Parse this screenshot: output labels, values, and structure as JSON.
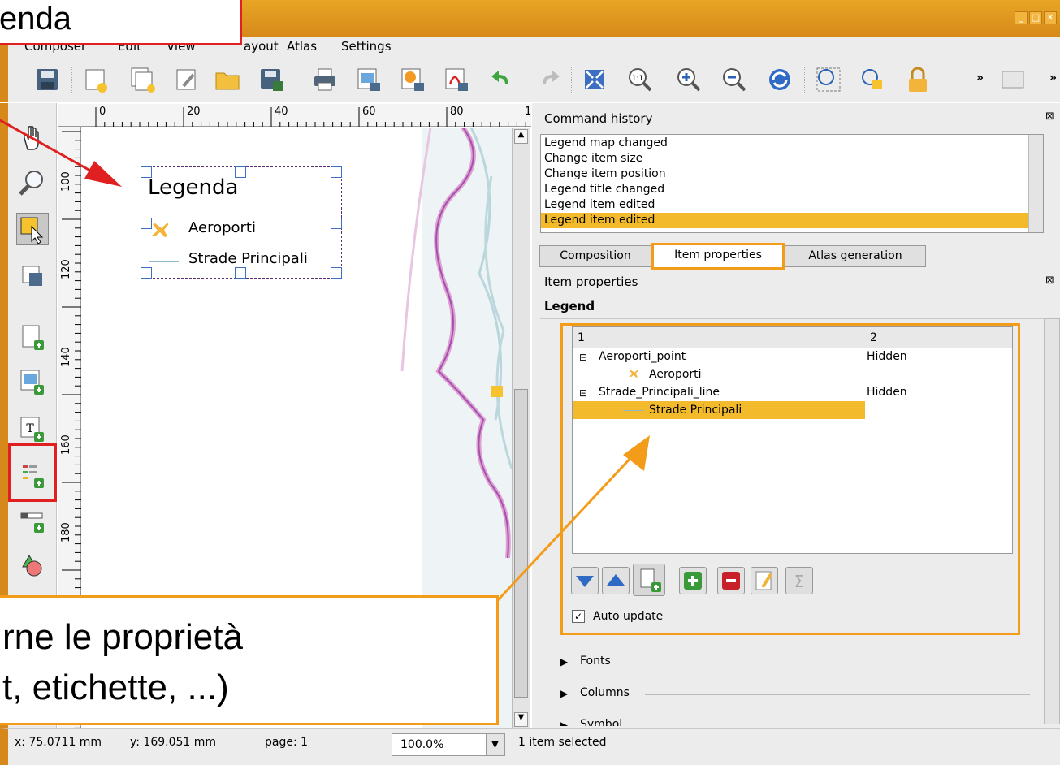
{
  "colors": {
    "titlebar": "#e0961f",
    "selection": "#f3bb2b",
    "annot_red": "#e02020",
    "annot_orange": "#f39c1a"
  },
  "annotation_top": {
    "text": "enda"
  },
  "annotation_bottom": {
    "line1": "rne le proprietà",
    "line2": "t, etichette, ...)"
  },
  "menu": {
    "composer": "Composer",
    "edit": "Edit",
    "view": "View",
    "layout": "ayout",
    "atlas": "Atlas",
    "settings": "Settings"
  },
  "toolbar_overflow": "»",
  "icons": {
    "toolbar": [
      "save-icon",
      "new-composer-icon",
      "duplicate-composer-icon",
      "composer-manager-icon",
      "open-template-icon",
      "save-template-icon",
      "print-icon",
      "export-image-icon",
      "export-svg-icon",
      "export-pdf-icon",
      "undo-icon",
      "redo-icon",
      "zoom-full-icon",
      "zoom-actual-icon",
      "zoom-in-icon",
      "zoom-out-icon",
      "refresh-icon",
      "lock-icon"
    ],
    "left": [
      "pan-icon",
      "zoom-icon",
      "select-move-item-icon",
      "move-content-icon",
      "add-new-map-icon",
      "add-image-icon",
      "add-label-icon",
      "add-legend-icon",
      "add-scalebar-icon",
      "add-shape-icon"
    ]
  },
  "ruler": {
    "h_labels": [
      "0",
      "20",
      "40",
      "60",
      "80",
      "1"
    ],
    "v_labels": [
      "100",
      "120",
      "140",
      "160",
      "180"
    ]
  },
  "legend_item": {
    "title": "Legenda",
    "entries": [
      "Aeroporti",
      "Strade Principali"
    ]
  },
  "history": {
    "title": "Command history",
    "items": [
      "Legend map changed",
      "Change item size",
      "Change item position",
      "Legend title changed",
      "Legend item edited",
      "Legend item edited"
    ]
  },
  "tabs": [
    "Composition",
    "Item properties",
    "Atlas generation"
  ],
  "item_props": {
    "header": "Item properties",
    "section": "Legend",
    "columns": [
      "1",
      "2"
    ],
    "tree": [
      {
        "label": "Aeroporti_point",
        "col2": "Hidden"
      },
      {
        "label": "Aeroporti",
        "col2": ""
      },
      {
        "label": "Strade_Principali_line",
        "col2": "Hidden"
      },
      {
        "label": "Strade Principali",
        "col2": ""
      }
    ],
    "auto_update": "Auto update",
    "groups": [
      "Fonts",
      "Columns",
      "Symbol"
    ]
  },
  "status": {
    "x": "x: 75.0711 mm",
    "y": "y: 169.051 mm",
    "page": "page: 1",
    "zoom": "100.0%",
    "selected": "1 item selected"
  }
}
